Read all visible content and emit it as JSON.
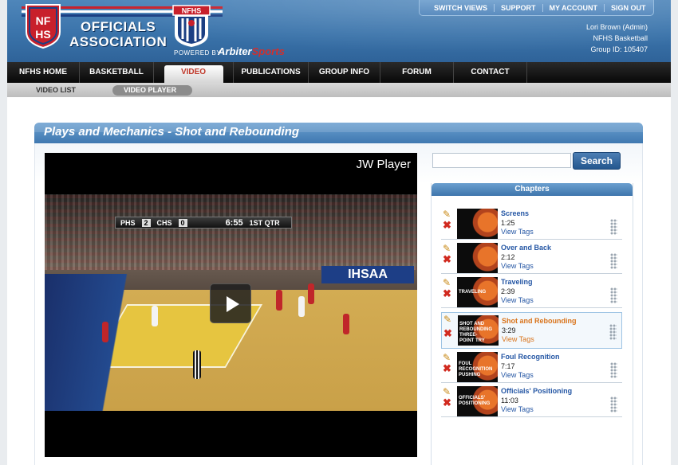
{
  "header": {
    "logo_shield_text": "NFHS",
    "logo_title_line1": "OFFICIALS",
    "logo_title_line2": "ASSOCIATION",
    "badge_text": "NFHS",
    "powered_by": "POWERED BY",
    "arbiter_part1": "Arbiter",
    "arbiter_part2": "Sports",
    "top_links": [
      "SWITCH VIEWS",
      "SUPPORT",
      "MY ACCOUNT",
      "SIGN OUT"
    ],
    "user_name": "Lori Brown (Admin)",
    "org_name": "NFHS Basketball",
    "group_id": "Group ID: 105407"
  },
  "nav": {
    "items": [
      "NFHS HOME",
      "BASKETBALL",
      "VIDEO",
      "PUBLICATIONS",
      "GROUP INFO",
      "FORUM",
      "CONTACT"
    ],
    "active": "VIDEO"
  },
  "subnav": {
    "items": [
      "VIDEO LIST",
      "VIDEO PLAYER"
    ],
    "active": "VIDEO PLAYER"
  },
  "page": {
    "title": "Plays and Mechanics - Shot and Rebounding"
  },
  "player": {
    "label": "JW Player",
    "scoreboard": {
      "team1": "PHS",
      "score1": "2",
      "team2": "CHS",
      "score2": "0",
      "clock": "6:55",
      "period": "1ST QTR"
    },
    "banner_text": "IHSAA"
  },
  "search": {
    "value": "",
    "placeholder": "",
    "button_label": "Search"
  },
  "chapters": {
    "header": "Chapters",
    "tags_label": "View Tags",
    "items": [
      {
        "title": "Screens",
        "duration": "1:25",
        "thumb_text": ""
      },
      {
        "title": "Over and Back",
        "duration": "2:12",
        "thumb_text": ""
      },
      {
        "title": "Traveling",
        "duration": "2:39",
        "thumb_text": "TRAVELING"
      },
      {
        "title": "Shot and Rebounding",
        "duration": "3:29",
        "thumb_text": "Shot and Rebounding Three-Point Try",
        "selected": true
      },
      {
        "title": "Foul Recognition",
        "duration": "7:17",
        "thumb_text": "FOUL RECOGNITION PUSHING"
      },
      {
        "title": "Officials' Positioning",
        "duration": "11:03",
        "thumb_text": "OFFICIALS' POSITIONING"
      }
    ]
  },
  "colors": {
    "header_blue": "#3a73aa",
    "nav_black": "#0a0a0a",
    "active_red": "#c0392b",
    "link_blue": "#2456a4",
    "selected_orange": "#d9731a"
  }
}
